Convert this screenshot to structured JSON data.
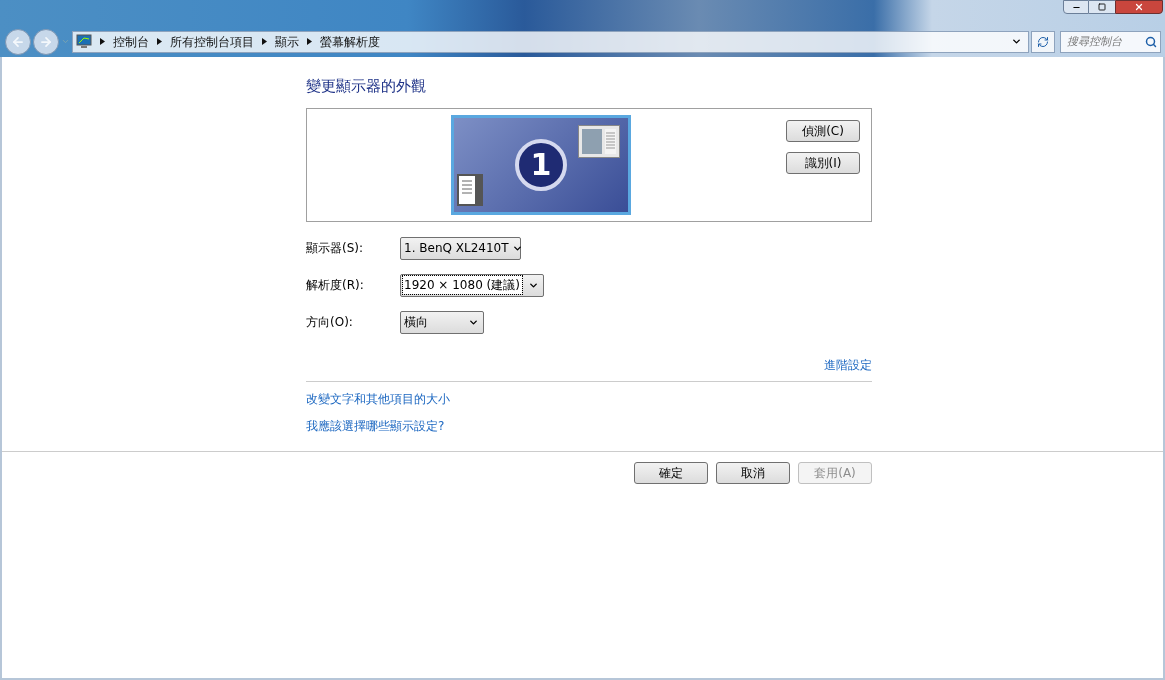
{
  "breadcrumb": [
    "控制台",
    "所有控制台項目",
    "顯示",
    "螢幕解析度"
  ],
  "search": {
    "placeholder": "搜尋控制台"
  },
  "title": "變更顯示器的外觀",
  "preview": {
    "monitor_number": "1",
    "buttons": [
      {
        "label": "偵測(C)"
      },
      {
        "label": "識別(I)"
      }
    ]
  },
  "fields": [
    {
      "label": "顯示器(S):",
      "value": "1. BenQ XL2410T",
      "focused": false
    },
    {
      "label": "解析度(R):",
      "value": "1920 × 1080 (建議)",
      "focused": true
    },
    {
      "label": "方向(O):",
      "value": "橫向",
      "focused": false
    }
  ],
  "advanced_link": "進階設定",
  "links": [
    "改變文字和其他項目的大小",
    "我應該選擇哪些顯示設定?"
  ],
  "buttons": [
    {
      "label": "確定",
      "disabled": false
    },
    {
      "label": "取消",
      "disabled": false
    },
    {
      "label": "套用(A)",
      "disabled": true
    }
  ]
}
